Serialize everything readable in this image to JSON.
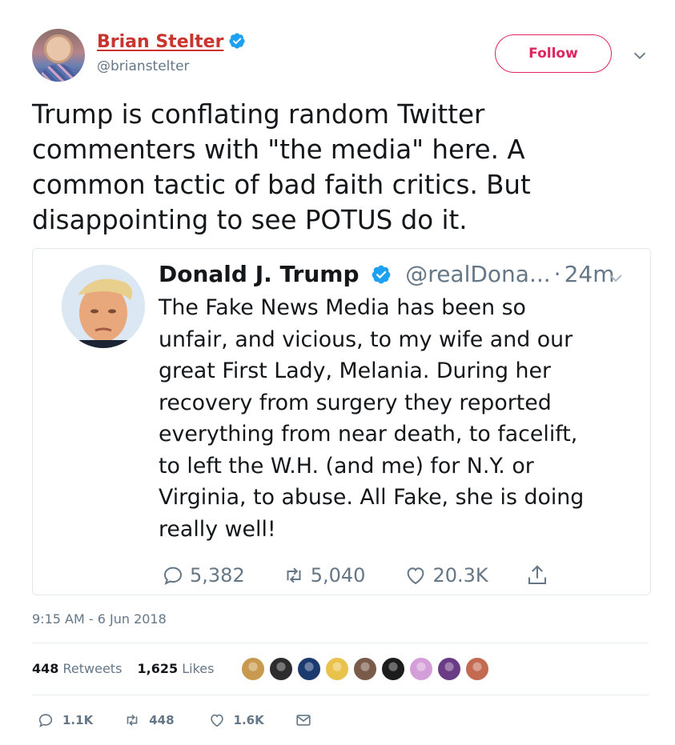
{
  "author": {
    "name": "Brian Stelter",
    "handle": "@brianstelter",
    "verified_color": "#1da1f2"
  },
  "follow_button": {
    "label": "Follow",
    "color": "#e0245e"
  },
  "tweet": {
    "lines": [
      "Trump is conflating random Twitter",
      "commenters with \"the media\" here. A",
      "common tactic of bad faith critics. But",
      "disappointing to see POTUS do it."
    ]
  },
  "quoted_tweet": {
    "name": "Donald J. Trump",
    "handle": "@realDona...",
    "separator": "·",
    "time": "24m",
    "lines": [
      "The Fake News Media has been so",
      "unfair, and vicious, to my wife and our",
      "great First Lady, Melania. During her",
      "recovery from surgery they reported",
      "everything from near death, to facelift,",
      "to left the W.H. (and me) for N.Y. or",
      "Virginia, to abuse. All Fake, she is doing",
      "really well!"
    ],
    "replies": "5,382",
    "retweets": "5,040",
    "likes": "20.3K"
  },
  "timestamp": "9:15 AM - 6 Jun 2018",
  "stats": {
    "retweet_count": "448",
    "retweet_label": "Retweets",
    "like_count": "1,625",
    "like_label": "Likes"
  },
  "likers": [
    {
      "icon": "liker-avatar-1",
      "color": "#c99a4e"
    },
    {
      "icon": "liker-avatar-2",
      "color": "#2d2d2d"
    },
    {
      "icon": "liker-avatar-3",
      "color": "#1b3b6f"
    },
    {
      "icon": "liker-avatar-4",
      "color": "#e8c24a"
    },
    {
      "icon": "liker-avatar-5",
      "color": "#7a5a48"
    },
    {
      "icon": "liker-avatar-6",
      "color": "#1c1c1c"
    },
    {
      "icon": "liker-avatar-7",
      "color": "#d49fd8"
    },
    {
      "icon": "liker-avatar-8",
      "color": "#6a3c86"
    },
    {
      "icon": "liker-avatar-9",
      "color": "#c46a52"
    }
  ],
  "actions": {
    "replies": "1.1K",
    "retweets": "448",
    "likes": "1.6K"
  }
}
